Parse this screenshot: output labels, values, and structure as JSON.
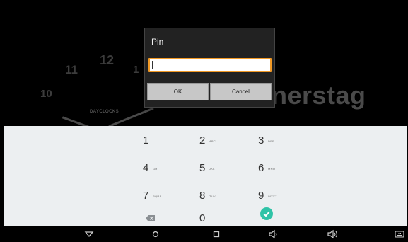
{
  "clock": {
    "numbers": [
      "12",
      "11",
      "10",
      "1"
    ],
    "brand": "DAYCLOCKS",
    "weekday_fragment": "nerstag"
  },
  "dialog": {
    "title": "Pin",
    "input_value": "",
    "ok_label": "OK",
    "cancel_label": "Cancel",
    "accent_color": "#f29a26"
  },
  "keypad": {
    "keys": [
      {
        "digit": "1",
        "letters": ""
      },
      {
        "digit": "2",
        "letters": "ABC"
      },
      {
        "digit": "3",
        "letters": "DEF"
      },
      {
        "digit": "4",
        "letters": "GHI"
      },
      {
        "digit": "5",
        "letters": "JKL"
      },
      {
        "digit": "6",
        "letters": "MNO"
      },
      {
        "digit": "7",
        "letters": "PQRS"
      },
      {
        "digit": "8",
        "letters": "TUV"
      },
      {
        "digit": "9",
        "letters": "WXYZ"
      },
      {
        "digit": "0",
        "letters": ""
      }
    ],
    "done_color": "#2fc3a7"
  },
  "navbar": {
    "icons": [
      "back-icon",
      "home-icon",
      "recents-icon",
      "volume-down-icon",
      "volume-up-icon",
      "keyboard-icon"
    ]
  }
}
